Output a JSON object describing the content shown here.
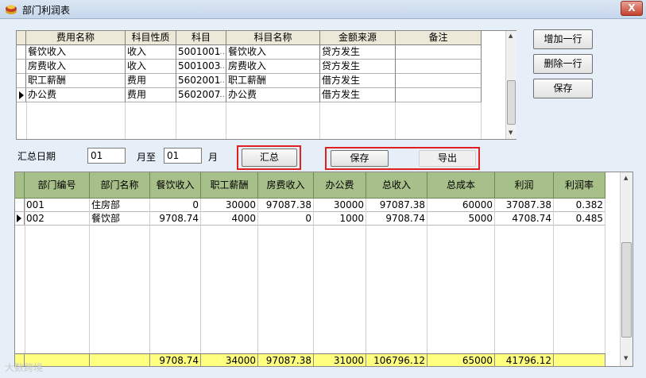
{
  "window": {
    "title": "部门利润表",
    "close_label": "X"
  },
  "top_grid": {
    "columns": [
      "费用名称",
      "科目性质",
      "科目",
      "科目名称",
      "金额来源",
      "备注"
    ],
    "rows": [
      {
        "fee_name": "餐饮收入",
        "nature": "收入",
        "subject": "5001001",
        "subject_name": "餐饮收入",
        "source": "贷方发生",
        "remark": "",
        "current": false
      },
      {
        "fee_name": "房费收入",
        "nature": "收入",
        "subject": "5001003",
        "subject_name": "房费收入",
        "source": "贷方发生",
        "remark": "",
        "current": false
      },
      {
        "fee_name": "职工薪酬",
        "nature": "费用",
        "subject": "5602001",
        "subject_name": "职工薪酬",
        "source": "借方发生",
        "remark": "",
        "current": false
      },
      {
        "fee_name": "办公费",
        "nature": "费用",
        "subject": "5602007",
        "subject_name": "办公费",
        "source": "借方发生",
        "remark": "",
        "current": true
      }
    ],
    "ellipsis": "…"
  },
  "side_buttons": {
    "add_row": "增加一行",
    "delete_row": "删除一行",
    "save": "保存"
  },
  "summary_bar": {
    "date_label": "汇总日期",
    "from_month": "01",
    "to_label": "月至",
    "to_month": "01",
    "month_label": "月",
    "summarize_button": "汇总",
    "save_button": "保存",
    "export_button": "导出"
  },
  "bottom_grid": {
    "columns": [
      "部门编号",
      "部门名称",
      "餐饮收入",
      "职工薪酬",
      "房费收入",
      "办公费",
      "总收入",
      "总成本",
      "利润",
      "利润率"
    ],
    "rows": [
      {
        "dept_no": "001",
        "dept_name": "住房部",
        "catering": "0",
        "salary": "30000",
        "room": "97087.38",
        "office": "30000",
        "income": "97087.38",
        "cost": "60000",
        "profit": "37087.38",
        "margin": "0.382",
        "current": false
      },
      {
        "dept_no": "002",
        "dept_name": "餐饮部",
        "catering": "9708.74",
        "salary": "4000",
        "room": "0",
        "office": "1000",
        "income": "9708.74",
        "cost": "5000",
        "profit": "4708.74",
        "margin": "0.485",
        "current": true
      }
    ],
    "totals": {
      "catering": "9708.74",
      "salary": "34000",
      "room": "97087.38",
      "office": "31000",
      "income": "106796.12",
      "cost": "65000",
      "profit": "41796.12"
    }
  },
  "watermark": "大数跨境"
}
